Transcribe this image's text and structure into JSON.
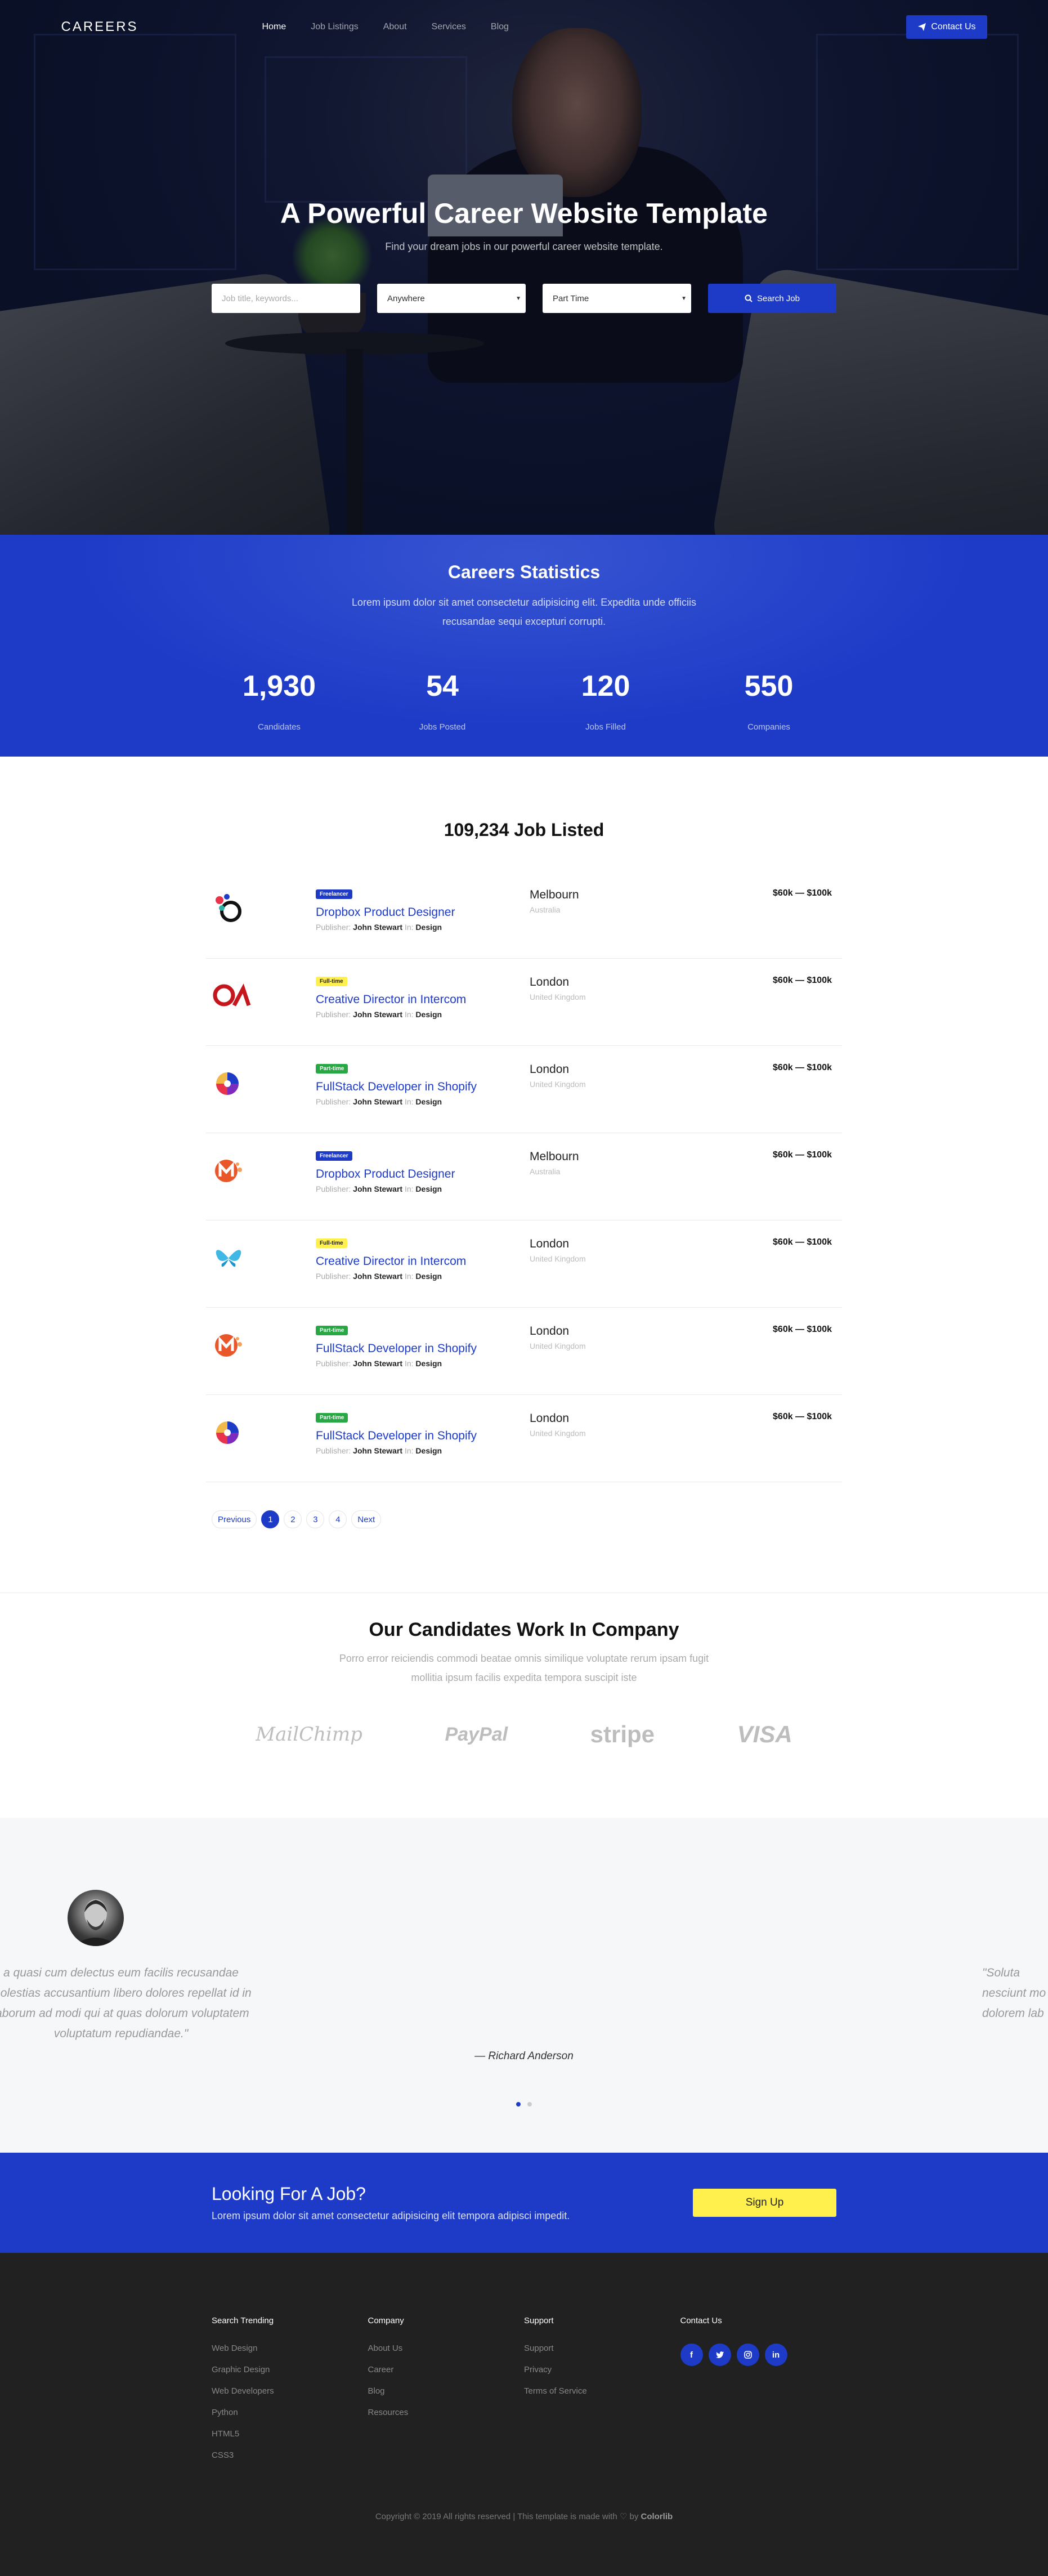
{
  "nav": {
    "logo": "CAREERS",
    "items": [
      "Home",
      "Job Listings",
      "About",
      "Services",
      "Blog"
    ],
    "contact_label": "Contact Us"
  },
  "hero": {
    "title": "A Powerful Career Website Template",
    "subtitle": "Find your dream jobs in our powerful career website template.",
    "keywords_placeholder": "Job title, keywords...",
    "location_value": "Anywhere",
    "type_value": "Part Time",
    "search_label": "Search Job"
  },
  "stats": {
    "title": "Careers Statistics",
    "text": "Lorem ipsum dolor sit amet consectetur adipisicing elit. Expedita unde officiis recusandae sequi excepturi corrupti.",
    "items": [
      {
        "num": "1,930",
        "label": "Candidates"
      },
      {
        "num": "54",
        "label": "Jobs Posted"
      },
      {
        "num": "120",
        "label": "Jobs Filled"
      },
      {
        "num": "550",
        "label": "Companies"
      }
    ]
  },
  "jobs": {
    "heading": "109,234 Job Listed",
    "publisher_prefix": "Publisher:",
    "in_label": "In:",
    "list": [
      {
        "logo": "dropbox-logo",
        "badge": "Freelancer",
        "badge_kind": "freelance",
        "title": "Dropbox Product Designer",
        "publisher": "John Stewart",
        "category": "Design",
        "city": "Melbourn",
        "country": "Australia",
        "salary": "$60k — $100k"
      },
      {
        "logo": "intercom-logo",
        "badge": "Full-time",
        "badge_kind": "fulltime",
        "title": "Creative Director in Intercom",
        "publisher": "John Stewart",
        "category": "Design",
        "city": "London",
        "country": "United Kingdom",
        "salary": "$60k — $100k"
      },
      {
        "logo": "shopify-logo",
        "badge": "Part-time",
        "badge_kind": "parttime",
        "title": "FullStack Developer in Shopify",
        "publisher": "John Stewart",
        "category": "Design",
        "city": "London",
        "country": "United Kingdom",
        "salary": "$60k — $100k"
      },
      {
        "logo": "m-logo",
        "badge": "Freelancer",
        "badge_kind": "freelance",
        "title": "Dropbox Product Designer",
        "publisher": "John Stewart",
        "category": "Design",
        "city": "Melbourn",
        "country": "Australia",
        "salary": "$60k — $100k"
      },
      {
        "logo": "butterfly-logo",
        "badge": "Full-time",
        "badge_kind": "fulltime",
        "title": "Creative Director in Intercom",
        "publisher": "John Stewart",
        "category": "Design",
        "city": "London",
        "country": "United Kingdom",
        "salary": "$60k — $100k"
      },
      {
        "logo": "m-logo",
        "badge": "Part-time",
        "badge_kind": "parttime",
        "title": "FullStack Developer in Shopify",
        "publisher": "John Stewart",
        "category": "Design",
        "city": "London",
        "country": "United Kingdom",
        "salary": "$60k — $100k"
      },
      {
        "logo": "shopify-logo",
        "badge": "Part-time",
        "badge_kind": "parttime",
        "title": "FullStack Developer in Shopify",
        "publisher": "John Stewart",
        "category": "Design",
        "city": "London",
        "country": "United Kingdom",
        "salary": "$60k — $100k"
      }
    ]
  },
  "pager": {
    "prev": "Previous",
    "pages": [
      "1",
      "2",
      "3",
      "4"
    ],
    "current": "1",
    "next": "Next"
  },
  "companies": {
    "title": "Our Candidates Work In Company",
    "text": "Porro error reiciendis commodi beatae omnis similique voluptate rerum ipsam fugit mollitia ipsum facilis expedita tempora suscipit iste",
    "brands": [
      "MailChimp",
      "PayPal",
      "stripe",
      "VISA"
    ]
  },
  "testimonial": {
    "quote": "a quasi cum delectus eum facilis recusandae\nmolestias accusantium libero dolores repellat id in\nlaborum ad modi qui at quas dolorum voluptatem\nvoluptatum repudiandae.\"",
    "next_quote": "\"Soluta\nnesciunt mo\ndolorem lab",
    "author": "— Richard Anderson"
  },
  "cta": {
    "title": "Looking For A Job?",
    "text": "Lorem ipsum dolor sit amet consectetur adipisicing elit tempora adipisci impedit.",
    "button": "Sign Up"
  },
  "footer": {
    "columns": [
      {
        "title": "Search Trending",
        "links": [
          "Web Design",
          "Graphic Design",
          "Web Developers",
          "Python",
          "HTML5",
          "CSS3"
        ]
      },
      {
        "title": "Company",
        "links": [
          "About Us",
          "Career",
          "Blog",
          "Resources"
        ]
      },
      {
        "title": "Support",
        "links": [
          "Support",
          "Privacy",
          "Terms of Service"
        ]
      }
    ],
    "contact_title": "Contact Us",
    "social": [
      "f",
      "t",
      "ig",
      "in"
    ],
    "copyright": "Copyright © 2019 All rights reserved | This template is made with",
    "by": "by",
    "brand": "Colorlib"
  },
  "colors": {
    "primary": "#1d3bc7",
    "accent": "#fff04d",
    "success": "#28a745",
    "footer_bg": "#212121"
  }
}
